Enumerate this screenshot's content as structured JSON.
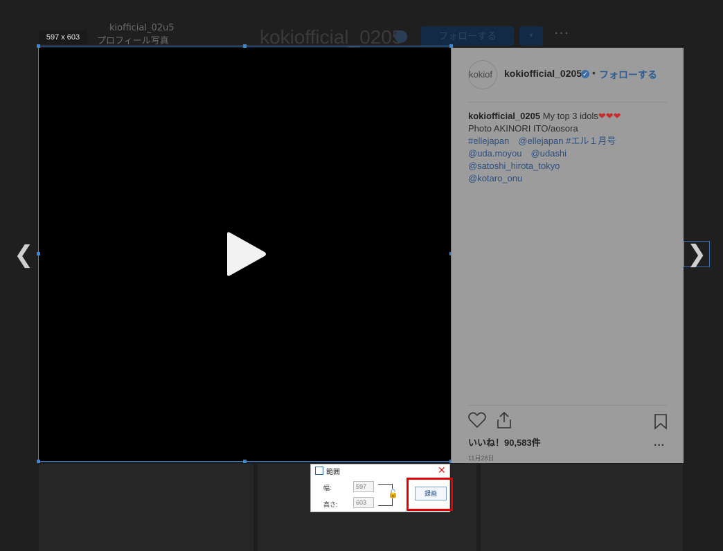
{
  "background": {
    "username_large": "kokiofficial_0205",
    "small_user": "kiofficial_02u5",
    "profile_photo_label": "プロフィール写真",
    "follow_label": "フォローする",
    "more": "···"
  },
  "selection": {
    "size_label": "597 x 603"
  },
  "post": {
    "avatar_alt": "kokiof",
    "username": "kokiofficial_0205",
    "dot": "•",
    "follow_label": "フォローする",
    "caption_user": "kokiofficial_0205",
    "caption_text": "My top 3 idols",
    "caption_hearts": "❤❤❤",
    "caption_lines": [
      "Photo AKINORI ITO/aosora",
      "#ellejapan　@ellejapan #エル１月号",
      "@uda.moyou　@udashi",
      "@satoshi_hirota_tokyo",
      "@kotaro_onu"
    ],
    "likes": "いいね！90,583件",
    "date": "11月28日",
    "more": "···"
  },
  "dialog": {
    "title": "範囲",
    "width_label": "幅:",
    "height_label": "高さ:",
    "width_value": "597",
    "height_value": "603",
    "record_label": "録画",
    "close": "✕"
  },
  "colors": {
    "accent": "#3a88d8",
    "highlight": "#e00000",
    "follow": "#2b5c96"
  }
}
